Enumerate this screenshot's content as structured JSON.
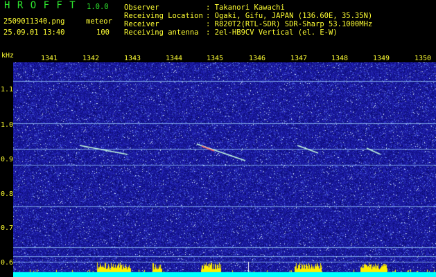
{
  "header": {
    "app_title": "H R O F F T",
    "version": "1.0.0",
    "filename": "2509011340.png",
    "mode": "meteor",
    "datetime": "25.09.01 13:40",
    "count": "100",
    "info_labels": [
      "Observer",
      "Receiving Location",
      "Receiver",
      "Receiving antenna"
    ],
    "info_values": [
      ": Takanori Kawachi",
      ": Ogaki, Gifu, JAPAN (136.60E, 35.35N)",
      ": R820T2(RTL-SDR) SDR-Sharp 53.1000MHz",
      ": 2el-HB9CV Vertical (el. E-W)"
    ]
  },
  "axis": {
    "unit": "kHz",
    "time_ticks": [
      "1341",
      "1342",
      "1343",
      "1344",
      "1345",
      "1346",
      "1347",
      "1348",
      "1349",
      "1350"
    ],
    "freq_ticks": [
      "1.1",
      "1.0",
      "0.9",
      "0.8",
      "0.7",
      "0.6"
    ]
  },
  "colors": {
    "background": "#000000",
    "spectrogram_noise": "#1a1aa0",
    "carrier_line": "#9fd3ff",
    "meteor_trace": "#c8ffe0",
    "signal_bar": "#ffee00",
    "baseline": "#00ffff"
  }
}
